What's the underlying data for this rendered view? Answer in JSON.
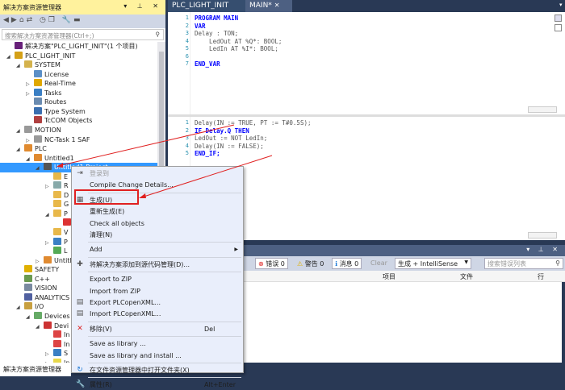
{
  "explorer": {
    "title": "解决方案资源管理器",
    "title_buttons": "▾ ⊥ ✕",
    "search_placeholder": "搜索解决方案资源管理器(Ctrl+;)",
    "bottom_tab": "解决方案资源管理器",
    "tree": [
      {
        "label": "解决方案\"PLC_LIGHT_INIT\"(1 个项目)",
        "level": 0,
        "arrow": "",
        "color": "#68217a"
      },
      {
        "label": "PLC_LIGHT_INIT",
        "level": 0,
        "arrow": "◢",
        "color": "#d4a017"
      },
      {
        "label": "SYSTEM",
        "level": 1,
        "arrow": "◢",
        "color": "#d4b24c"
      },
      {
        "label": "License",
        "level": 2,
        "arrow": "",
        "color": "#5b8fc7"
      },
      {
        "label": "Real-Time",
        "level": 2,
        "arrow": "▷",
        "color": "#e0a800"
      },
      {
        "label": "Tasks",
        "level": 2,
        "arrow": "▷",
        "color": "#3a7fc4"
      },
      {
        "label": "Routes",
        "level": 2,
        "arrow": "",
        "color": "#6a8bb0"
      },
      {
        "label": "Type System",
        "level": 2,
        "arrow": "",
        "color": "#3a6fb0"
      },
      {
        "label": "TcCOM Objects",
        "level": 2,
        "arrow": "",
        "color": "#b04040"
      },
      {
        "label": "MOTION",
        "level": 1,
        "arrow": "◢",
        "color": "#999"
      },
      {
        "label": "NC-Task 1 SAF",
        "level": 2,
        "arrow": "▷",
        "color": "#999"
      },
      {
        "label": "PLC",
        "level": 1,
        "arrow": "◢",
        "color": "#e08a30"
      },
      {
        "label": "Untitled1",
        "level": 2,
        "arrow": "◢",
        "color": "#e08a30"
      },
      {
        "label": "Untitled1 Project",
        "level": 3,
        "arrow": "◢",
        "color": "#555",
        "selected": true
      },
      {
        "label": "E",
        "level": 4,
        "arrow": "",
        "color": "#e8b84a"
      },
      {
        "label": "R",
        "level": 4,
        "arrow": "▷",
        "color": "#8aa"
      },
      {
        "label": "D",
        "level": 4,
        "arrow": "",
        "color": "#e8b84a"
      },
      {
        "label": "G",
        "level": 4,
        "arrow": "",
        "color": "#e8b84a"
      },
      {
        "label": "P",
        "level": 4,
        "arrow": "◢",
        "color": "#e8b84a"
      },
      {
        "label": "",
        "level": 5,
        "arrow": "",
        "color": "#d33"
      },
      {
        "label": "V",
        "level": 4,
        "arrow": "",
        "color": "#e8b84a"
      },
      {
        "label": "P",
        "level": 4,
        "arrow": "▷",
        "color": "#3a7fc4"
      },
      {
        "label": "L",
        "level": 4,
        "arrow": "",
        "color": "#5a5"
      },
      {
        "label": "Untitled",
        "level": 3,
        "arrow": "▷",
        "color": "#e08a30"
      },
      {
        "label": "SAFETY",
        "level": 1,
        "arrow": "",
        "color": "#e0b000"
      },
      {
        "label": "C++",
        "level": 1,
        "arrow": "",
        "color": "#6a9a50"
      },
      {
        "label": "VISION",
        "level": 1,
        "arrow": "",
        "color": "#7a8aa0"
      },
      {
        "label": "ANALYTICS",
        "level": 1,
        "arrow": "",
        "color": "#5060a0"
      },
      {
        "label": "I/O",
        "level": 1,
        "arrow": "◢",
        "color": "#c8a040"
      },
      {
        "label": "Devices",
        "level": 2,
        "arrow": "◢",
        "color": "#6a6"
      },
      {
        "label": "Devi",
        "level": 3,
        "arrow": "◢",
        "color": "#c33"
      },
      {
        "label": "In",
        "level": 4,
        "arrow": "",
        "color": "#d44"
      },
      {
        "label": "In",
        "level": 4,
        "arrow": "",
        "color": "#d44"
      },
      {
        "label": "S",
        "level": 4,
        "arrow": "▷",
        "color": "#3a7fc4"
      },
      {
        "label": "In",
        "level": 4,
        "arrow": "▷",
        "color": "#e8d84a"
      }
    ]
  },
  "editor": {
    "tabs": [
      {
        "label": "PLC_LIGHT_INIT",
        "active": false
      },
      {
        "label": "MAIN*",
        "active": true
      }
    ],
    "decl_lines": [
      [
        "1",
        "PROGRAM MAIN"
      ],
      [
        "2",
        "VAR"
      ],
      [
        "3",
        "Delay : TON;"
      ],
      [
        "4",
        "    LedOut AT %Q*: BOOL;"
      ],
      [
        "5",
        "    LedIn AT %I*: BOOL;"
      ],
      [
        "6",
        ""
      ],
      [
        "7",
        "END_VAR"
      ]
    ],
    "impl_lines": [
      [
        "1",
        "Delay(IN := TRUE, PT := T#0.5S);"
      ],
      [
        "2",
        "IF Delay.Q THEN"
      ],
      [
        "3",
        "LedOut := NOT LedIn;"
      ],
      [
        "4",
        "Delay(IN := FALSE);"
      ],
      [
        "5",
        "END_IF;"
      ]
    ]
  },
  "error_list": {
    "title_buttons": "▾ ⊥ ✕",
    "errors": "错误 0",
    "warnings": "警告 0",
    "messages": "消息 0",
    "clear": "Clear",
    "filter": "生成 + IntelliSense",
    "search_placeholder": "搜索错误列表",
    "columns": [
      "项目",
      "文件",
      "行"
    ]
  },
  "context_menu": {
    "items": [
      {
        "label": "登录到",
        "disabled": true,
        "icon": "login-icon"
      },
      {
        "label": "Compile Change Details..."
      },
      {
        "sep": true
      },
      {
        "label": "生成(U)",
        "icon": "build-icon",
        "highlighted": true
      },
      {
        "label": "重新生成(E)"
      },
      {
        "label": "Check all objects"
      },
      {
        "label": "清理(N)"
      },
      {
        "sep": true
      },
      {
        "label": "Add",
        "submenu": true
      },
      {
        "sep": true
      },
      {
        "label": "将解决方案添加到源代码管理(D)...",
        "icon": "add-source-control-icon"
      },
      {
        "sep": true
      },
      {
        "label": "Export to ZIP"
      },
      {
        "label": "Import from ZIP"
      },
      {
        "label": "Export PLCopenXML...",
        "icon": "export-xml-icon"
      },
      {
        "label": "Import PLCopenXML...",
        "icon": "import-xml-icon"
      },
      {
        "sep": true
      },
      {
        "label": "移除(V)",
        "icon": "remove-icon",
        "shortcut": "Del"
      },
      {
        "sep": true
      },
      {
        "label": "Save as library ..."
      },
      {
        "label": "Save as library and install ..."
      },
      {
        "sep": true
      },
      {
        "label": "在文件资源管理器中打开文件夹(X)",
        "icon": "open-folder-icon"
      },
      {
        "sep": true
      },
      {
        "label": "属性(R)",
        "icon": "wrench-icon",
        "shortcut": "Alt+Enter"
      }
    ]
  },
  "colors": {
    "accent": "#3399ff",
    "annotation": "#e02020",
    "title_bar": "#fff29d",
    "frame": "#293955"
  }
}
